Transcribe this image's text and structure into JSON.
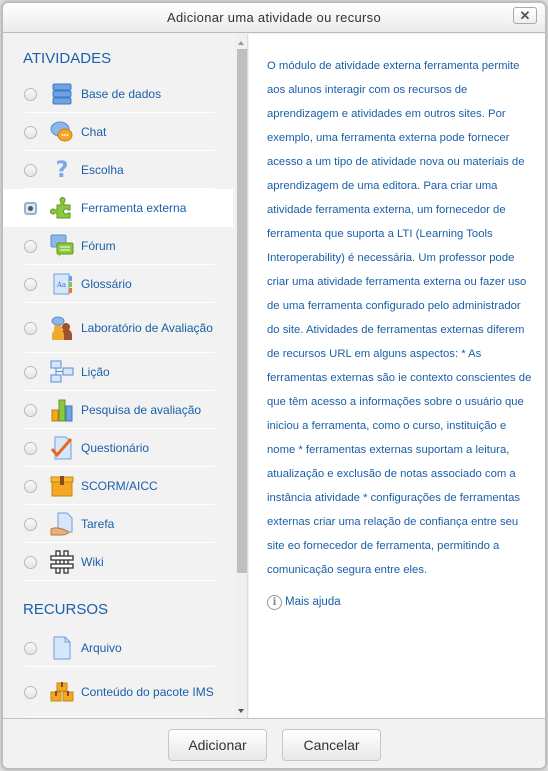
{
  "dialog": {
    "title": "Adicionar uma atividade ou recurso",
    "close_icon": "close-x-icon"
  },
  "activities": {
    "heading": "ATIVIDADES",
    "items": [
      {
        "label": "Base de dados",
        "icon": "database-icon",
        "selected": false
      },
      {
        "label": "Chat",
        "icon": "chat-bubbles-icon",
        "selected": false
      },
      {
        "label": "Escolha",
        "icon": "question-mark-icon",
        "selected": false
      },
      {
        "label": "Ferramenta externa",
        "icon": "puzzle-piece-icon",
        "selected": true
      },
      {
        "label": "Fórum",
        "icon": "forum-bubbles-icon",
        "selected": false
      },
      {
        "label": "Glossário",
        "icon": "glossary-book-icon",
        "selected": false
      },
      {
        "label": "Laboratório de Avaliação",
        "icon": "workshop-people-icon",
        "selected": false
      },
      {
        "label": "Lição",
        "icon": "lesson-flowchart-icon",
        "selected": false
      },
      {
        "label": "Pesquisa de avaliação",
        "icon": "bar-chart-icon",
        "selected": false
      },
      {
        "label": "Questionário",
        "icon": "quiz-checkmark-icon",
        "selected": false
      },
      {
        "label": "SCORM/AICC",
        "icon": "scorm-package-icon",
        "selected": false
      },
      {
        "label": "Tarefa",
        "icon": "assignment-hand-icon",
        "selected": false
      },
      {
        "label": "Wiki",
        "icon": "wiki-hash-icon",
        "selected": false
      }
    ]
  },
  "resources": {
    "heading": "RECURSOS",
    "items": [
      {
        "label": "Arquivo",
        "icon": "file-icon",
        "selected": false
      },
      {
        "label": "Conteúdo do pacote IMS",
        "icon": "ims-boxes-icon",
        "selected": false
      },
      {
        "label": "",
        "icon": "folder-icon",
        "selected": false
      }
    ]
  },
  "help": {
    "text": "O módulo de atividade externa ferramenta permite aos alunos interagir com os recursos de aprendizagem e atividades em outros sites. Por exemplo, uma ferramenta externa pode fornecer acesso a um tipo de atividade nova ou materiais de aprendizagem de uma editora. Para criar uma atividade ferramenta externa, um fornecedor de ferramenta que suporta a LTI (Learning Tools Interoperability) é necessária. Um professor pode criar uma atividade ferramenta externa ou fazer uso de uma ferramenta configurado pelo administrador do site. Atividades de ferramentas externas diferem de recursos URL em alguns aspectos: * As ferramentas externas são ie contexto conscientes de que têm acesso a informações sobre o usuário que iniciou a ferramenta, como o curso, instituição e nome * ferramentas externas suportam a leitura, atualização e exclusão de notas associado com a instância atividade * configurações de ferramentas externas criar uma relação de confiança entre seu site eo fornecedor de ferramenta, permitindo a comunicação segura entre eles.",
    "more_help_label": "Mais ajuda",
    "info_glyph": "i"
  },
  "footer": {
    "add_label": "Adicionar",
    "cancel_label": "Cancelar"
  },
  "colors": {
    "link": "#1a5fa8",
    "selected_row": "#ffffff",
    "panel_bg": "#f2f2f2"
  }
}
